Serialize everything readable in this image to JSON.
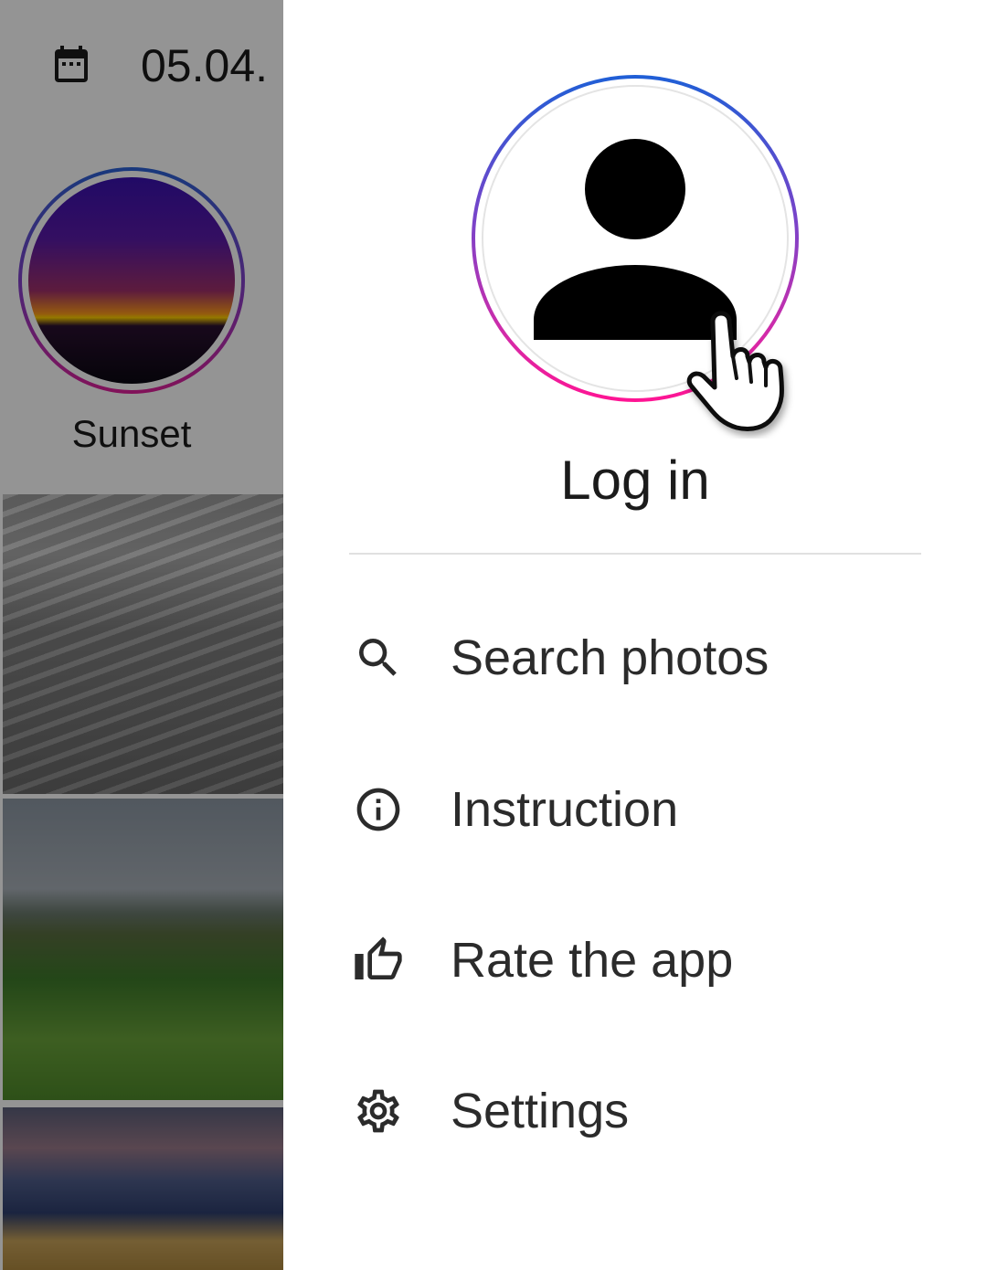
{
  "background": {
    "date_text": "05.04.",
    "story": {
      "label": "Sunset"
    }
  },
  "drawer": {
    "login_label": "Log in",
    "menu": [
      {
        "label": "Search photos",
        "icon": "search-icon"
      },
      {
        "label": "Instruction",
        "icon": "info-icon"
      },
      {
        "label": "Rate the app",
        "icon": "thumb-up-icon"
      },
      {
        "label": "Settings",
        "icon": "gear-icon"
      }
    ]
  },
  "colors": {
    "ring_top": "#1f5fd6",
    "ring_bottom": "#ff1493",
    "text_primary": "#1b1b1b",
    "scrim": "rgba(0,0,0,0.42)"
  }
}
